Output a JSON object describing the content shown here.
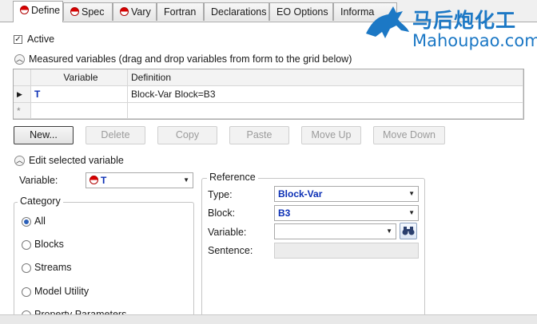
{
  "tabs": [
    {
      "label": "Define",
      "status_icon": "red-half-circle-icon",
      "active": true
    },
    {
      "label": "Spec",
      "status_icon": "red-half-circle-icon"
    },
    {
      "label": "Vary",
      "status_icon": "red-half-circle-icon"
    },
    {
      "label": "Fortran"
    },
    {
      "label": "Declarations"
    },
    {
      "label": "EO Options"
    },
    {
      "label": "Informa"
    }
  ],
  "watermark": {
    "chinese": "马后炮化工",
    "latin": "Mahoupao.com"
  },
  "active_checkbox": {
    "label": "Active",
    "checked": true
  },
  "measured_section": {
    "label": "Measured variables (drag and drop variables from form to the grid below)"
  },
  "grid": {
    "columns": [
      "Variable",
      "Definition"
    ],
    "rows": [
      {
        "marker": "▶",
        "variable": "T",
        "definition": "Block-Var Block=B3"
      },
      {
        "marker": "*",
        "variable": "",
        "definition": ""
      }
    ]
  },
  "buttons": {
    "new": "New...",
    "delete": "Delete",
    "copy": "Copy",
    "paste": "Paste",
    "move_up": "Move Up",
    "move_down": "Move Down"
  },
  "edit_section": {
    "label": "Edit selected variable"
  },
  "variable_field": {
    "label": "Variable:",
    "value": "T"
  },
  "category": {
    "legend": "Category",
    "options": [
      "All",
      "Blocks",
      "Streams",
      "Model Utility",
      "Property Parameters"
    ],
    "selected": "All"
  },
  "reference": {
    "legend": "Reference",
    "type": {
      "label": "Type:",
      "value": "Block-Var"
    },
    "block": {
      "label": "Block:",
      "value": "B3"
    },
    "variable": {
      "label": "Variable:",
      "value": ""
    },
    "sentence": {
      "label": "Sentence:",
      "value": ""
    }
  },
  "colors": {
    "accent_text": "#0b2fb5",
    "status_red": "#d80000",
    "watermark_blue": "#1c78c5"
  }
}
